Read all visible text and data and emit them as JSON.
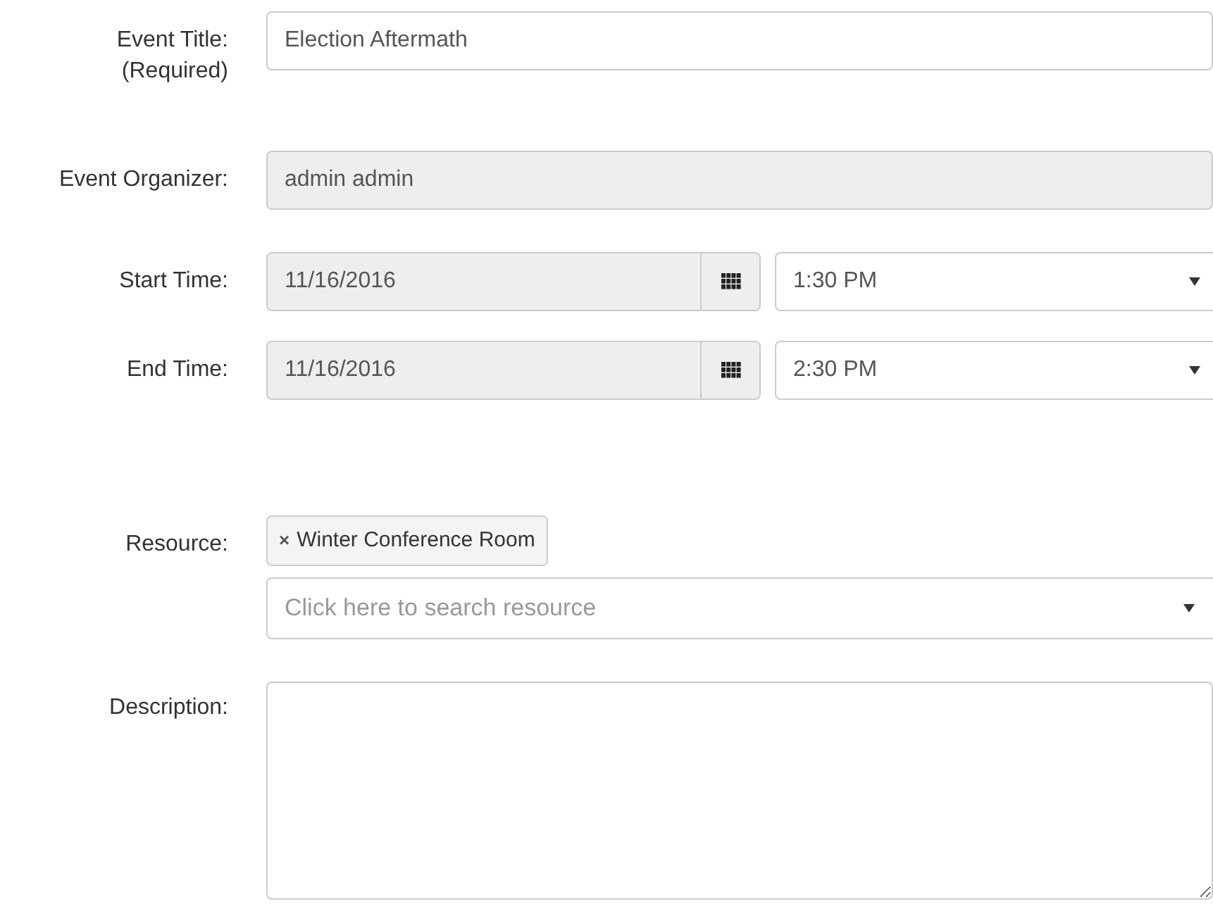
{
  "fields": [
    {
      "kind": "text",
      "label": "Event Title:",
      "sublabel": "(Required)",
      "value": "Election Aftermath",
      "disabled": false
    },
    {
      "kind": "text",
      "label": "Event Organizer:",
      "value": "admin admin",
      "disabled": true
    },
    {
      "kind": "datetime",
      "label": "Start Time:",
      "date": "11/16/2016",
      "time": "1:30 PM"
    },
    {
      "kind": "datetime",
      "label": "End Time:",
      "date": "11/16/2016",
      "time": "2:30 PM"
    },
    {
      "kind": "multiselect",
      "label": "Resource:",
      "tags": [
        {
          "remove": "×",
          "text": "Winter Conference Room"
        }
      ],
      "placeholder": "Click here to search resource"
    },
    {
      "kind": "textarea",
      "label": "Description:"
    }
  ]
}
